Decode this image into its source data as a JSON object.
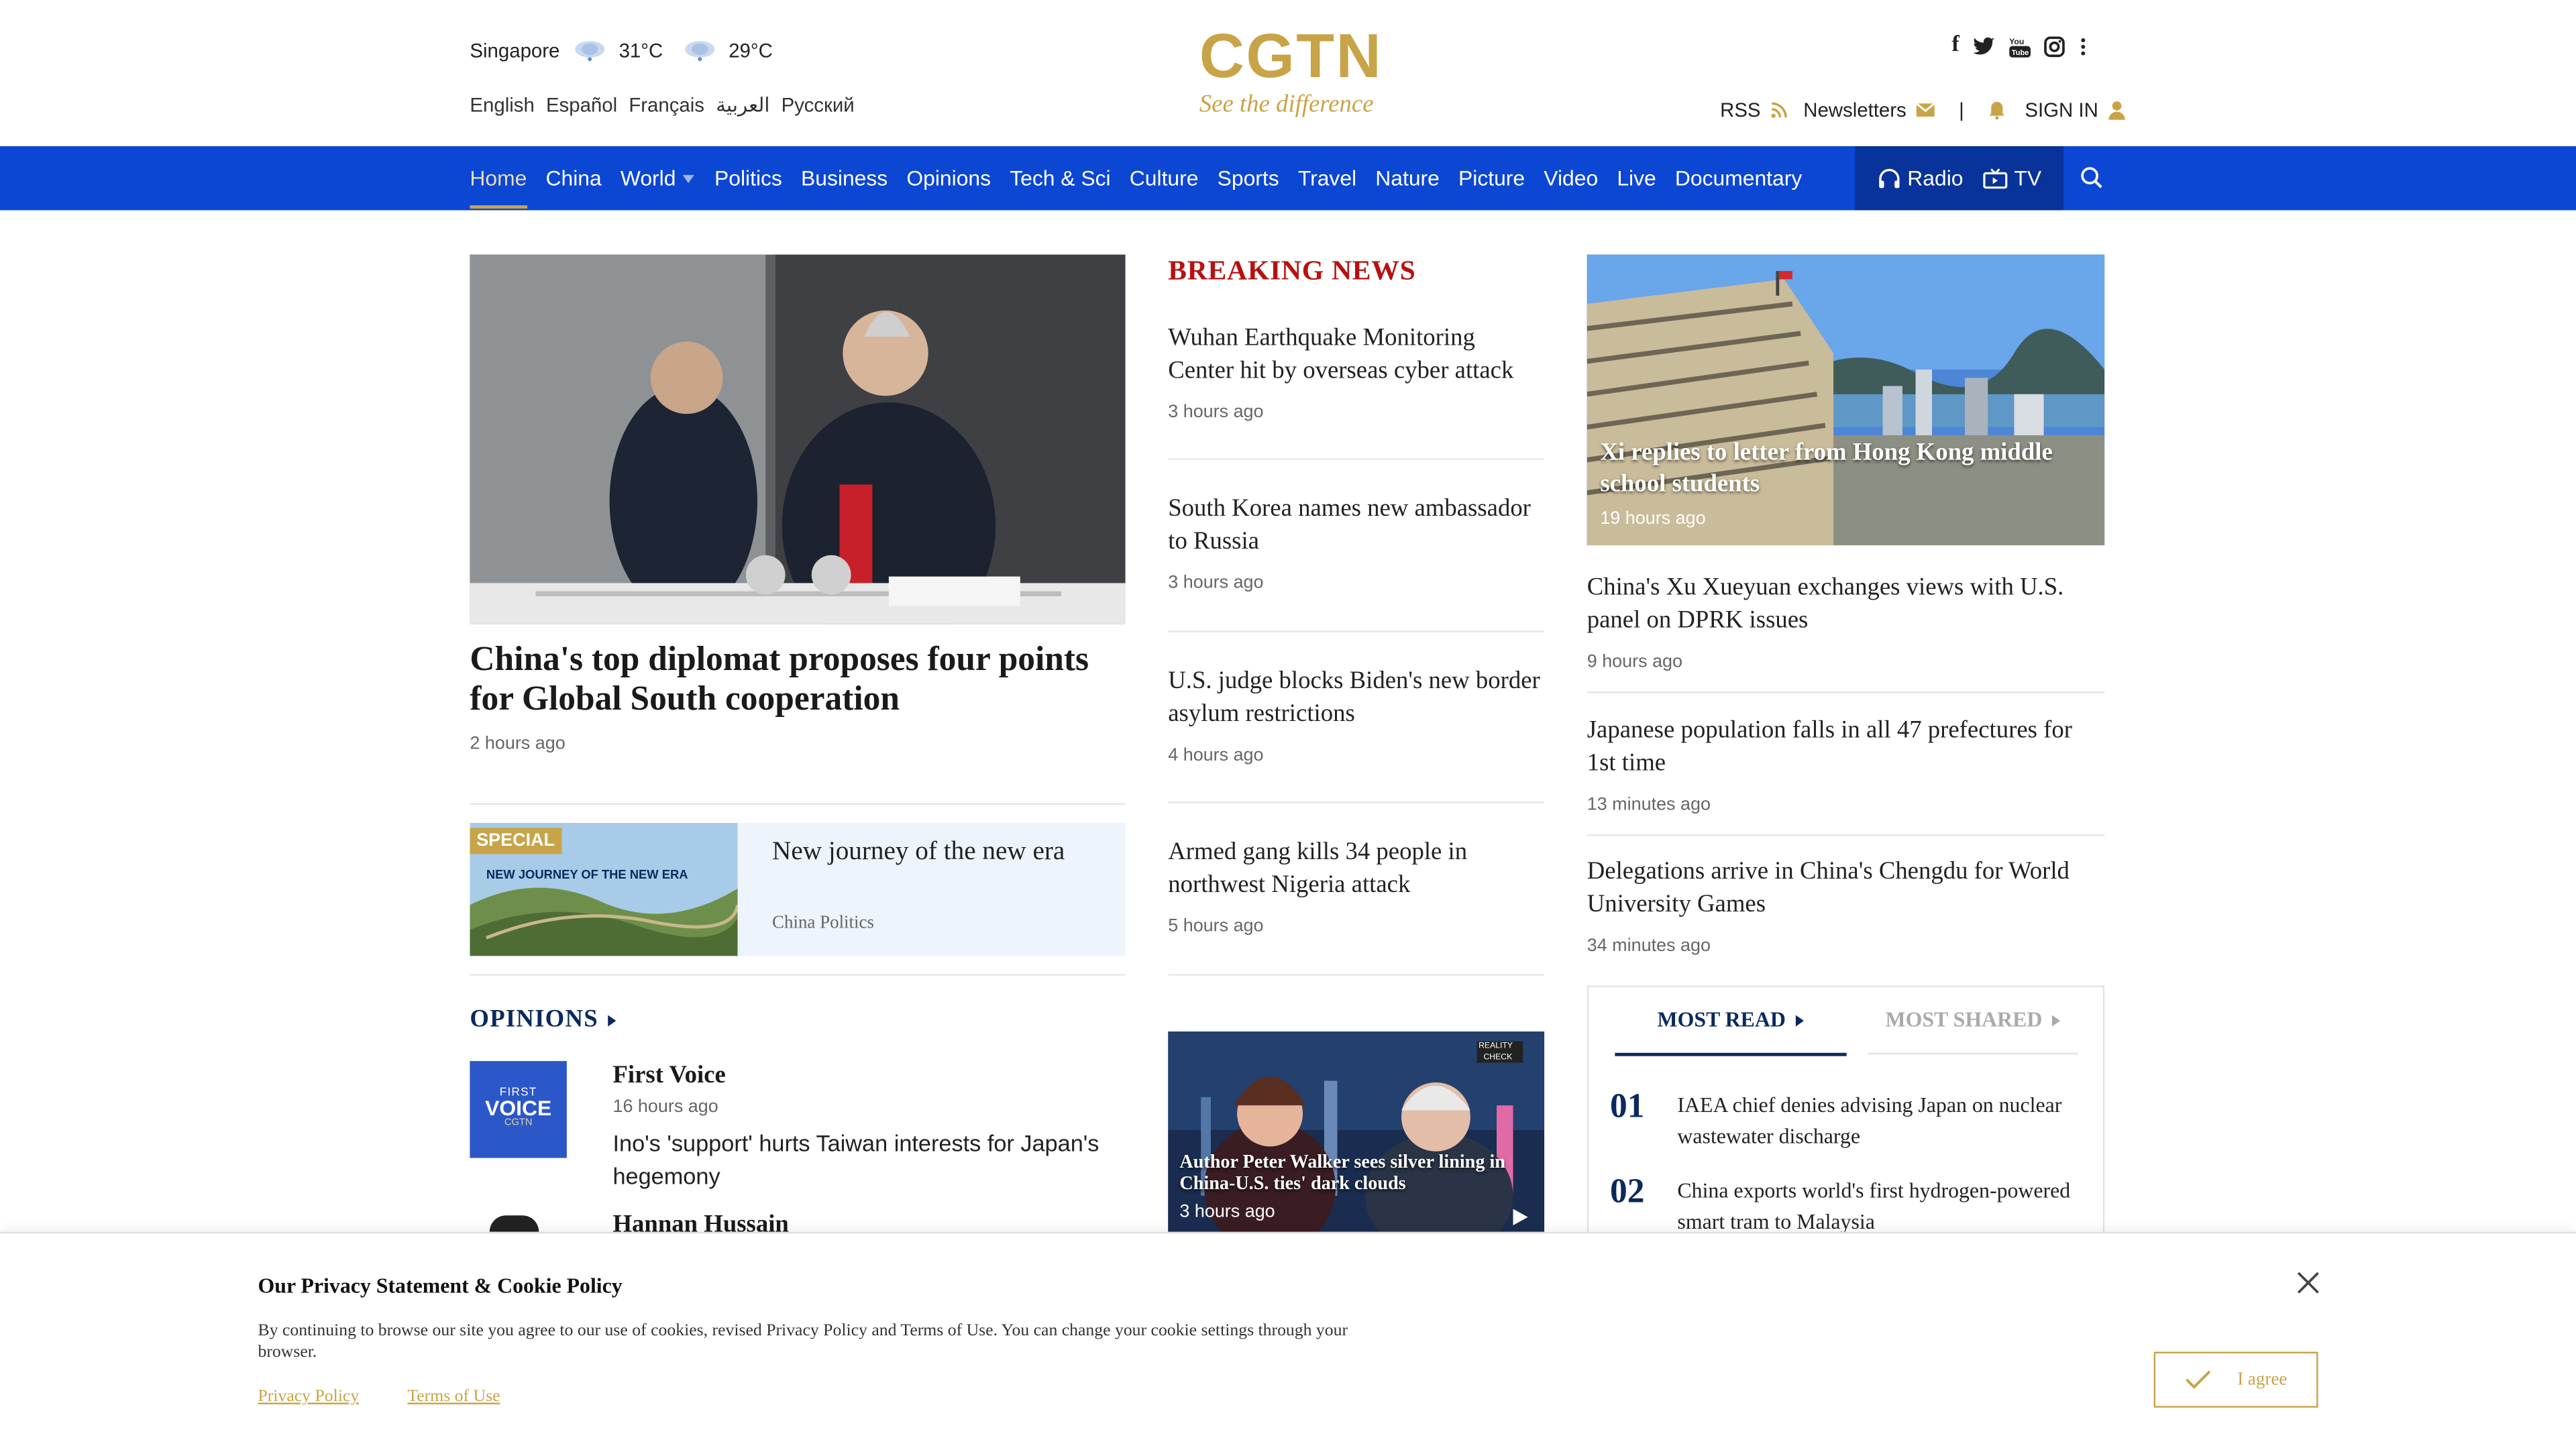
{
  "header": {
    "city": "Singapore",
    "temp1": "31°C",
    "temp2": "29°C",
    "languages": [
      "English",
      "Español",
      "Français",
      "العربية",
      "Русский"
    ],
    "logo_main": "CGTN",
    "logo_tagline": "See the difference",
    "social_icons": [
      "facebook-icon",
      "twitter-icon",
      "youtube-icon",
      "instagram-icon",
      "more-icon"
    ],
    "rss": "RSS",
    "newsletters": "Newsletters",
    "sign_in": "SIGN IN"
  },
  "nav": {
    "items": [
      "Home",
      "China",
      "World",
      "Politics",
      "Business",
      "Opinions",
      "Tech & Sci",
      "Culture",
      "Sports",
      "Travel",
      "Nature",
      "Picture",
      "Video",
      "Live",
      "Documentary"
    ],
    "active": "Home",
    "radio": "Radio",
    "tv": "TV"
  },
  "hero": {
    "title": "China's top diplomat proposes four points for Global South cooperation",
    "time": "2 hours ago"
  },
  "special": {
    "tag": "SPECIAL",
    "image_caption": "NEW JOURNEY OF THE NEW ERA",
    "title": "New journey of the new era",
    "subtitle": "China Politics"
  },
  "opinions": {
    "heading": "OPINIONS",
    "logo_text_1": "FIRST",
    "logo_text_2": "VOICE",
    "logo_text_3": "CGTN",
    "items": [
      {
        "author": "First Voice",
        "time": "16 hours ago",
        "text": "Ino's 'support' hurts Taiwan interests for Japan's hegemony"
      },
      {
        "author": "Hannan Hussain"
      }
    ]
  },
  "breaking": {
    "heading": "BREAKING NEWS",
    "items": [
      {
        "title": "Wuhan Earthquake Monitoring Center hit by overseas cyber attack",
        "time": "3 hours ago"
      },
      {
        "title": "South Korea names new ambassador to Russia",
        "time": "3 hours ago"
      },
      {
        "title": "U.S. judge blocks Biden's new border asylum restrictions",
        "time": "4 hours ago"
      },
      {
        "title": "Armed gang kills 34 people in northwest Nigeria attack",
        "time": "5 hours ago"
      }
    ],
    "video": {
      "badge_1": "REALITY",
      "badge_2": "CHECK",
      "title": "Author Peter Walker sees silver lining in China-U.S. ties' dark clouds",
      "time": "3 hours ago"
    }
  },
  "right": {
    "feature": {
      "title": "Xi replies to letter from Hong Kong middle school students",
      "time": "19 hours ago"
    },
    "items": [
      {
        "title": "China's Xu Xueyuan exchanges views with U.S. panel on DPRK issues",
        "time": "9 hours ago"
      },
      {
        "title": "Japanese population falls in all 47 prefectures for 1st time",
        "time": "13 minutes ago"
      },
      {
        "title": "Delegations arrive in China's Chengdu for World University Games",
        "time": "34 minutes ago"
      }
    ],
    "most_read_tab": "MOST READ",
    "most_shared_tab": "MOST SHARED",
    "ranked": [
      {
        "rank": "01",
        "title": "IAEA chief denies advising Japan on nuclear wastewater discharge"
      },
      {
        "rank": "02",
        "title": "China exports world's first hydrogen-powered smart tram to Malaysia"
      }
    ]
  },
  "cookie": {
    "title": "Our Privacy Statement & Cookie Policy",
    "body": "By continuing to browse our site you agree to our use of cookies, revised Privacy Policy and Terms of Use. You can change your cookie settings through your browser.",
    "privacy_link": "Privacy Policy",
    "terms_link": "Terms of Use",
    "agree": "I agree"
  },
  "colors": {
    "nav_blue": "#0c47d4",
    "brand_gold": "#c8a448",
    "breaking_red": "#b8100f",
    "navy": "#0a2a5e"
  }
}
